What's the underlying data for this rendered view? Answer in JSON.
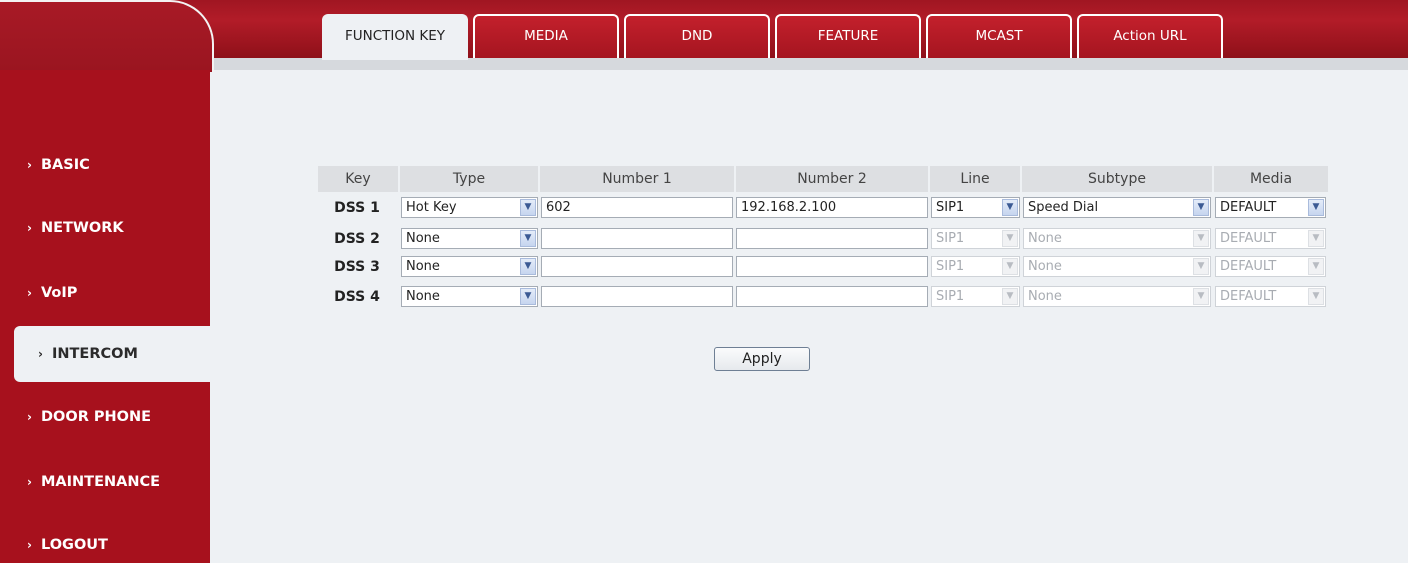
{
  "tabs": [
    "FUNCTION KEY",
    "MEDIA",
    "DND",
    "FEATURE",
    "MCAST",
    "Action URL"
  ],
  "sidebar": {
    "items": [
      "BASIC",
      "NETWORK",
      "VoIP",
      "INTERCOM",
      "DOOR PHONE",
      "MAINTENANCE",
      "LOGOUT"
    ],
    "active": "INTERCOM"
  },
  "table": {
    "headers": [
      "Key",
      "Type",
      "Number 1",
      "Number 2",
      "Line",
      "Subtype",
      "Media"
    ],
    "rows": [
      {
        "key": "DSS 1",
        "type": "Hot Key",
        "number1": "602",
        "number2": "192.168.2.100",
        "line": "SIP1",
        "subtype": "Speed Dial",
        "media": "DEFAULT"
      },
      {
        "key": "DSS 2",
        "type": "None",
        "number1": "",
        "number2": "",
        "line": "SIP1",
        "subtype": "None",
        "media": "DEFAULT"
      },
      {
        "key": "DSS 3",
        "type": "None",
        "number1": "",
        "number2": "",
        "line": "SIP1",
        "subtype": "None",
        "media": "DEFAULT"
      },
      {
        "key": "DSS 4",
        "type": "None",
        "number1": "",
        "number2": "",
        "line": "SIP1",
        "subtype": "None",
        "media": "DEFAULT"
      }
    ]
  },
  "apply_label": "Apply",
  "icons": {
    "nav_arrow": "chevron-right-icon",
    "dropdown": "chevron-down-icon"
  },
  "colors": {
    "brand_red": "#a7111d",
    "background": "#eef1f4"
  }
}
